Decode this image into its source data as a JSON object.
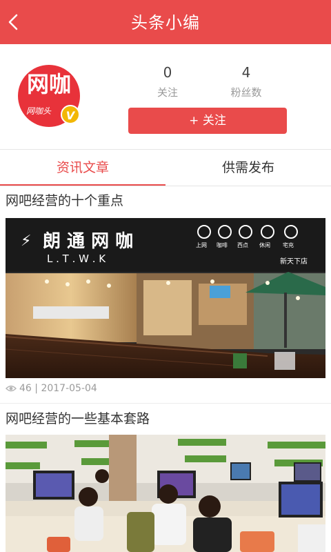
{
  "header": {
    "title": "头条小编",
    "back_icon": "chevron-left-icon"
  },
  "profile": {
    "avatar_text": "网咖",
    "avatar_subtext": "网咖头",
    "verified_badge": "V",
    "following_count": "0",
    "following_label": "关注",
    "fans_count": "4",
    "fans_label": "粉丝数",
    "follow_button": "+ 关注"
  },
  "tabs": [
    {
      "label": "资讯文章",
      "active": true
    },
    {
      "label": "供需发布",
      "active": false
    }
  ],
  "articles": [
    {
      "title": "网吧经营的十个重点",
      "views": "46",
      "date": "2017-05-04",
      "image_sign_text": "朗 通 网 咖",
      "image_sign_latin": "L . T . W . K",
      "image_store_text": "新天下店",
      "image_service_labels": [
        "上网",
        "咖啡",
        "西点",
        "休闲",
        "宅充"
      ]
    },
    {
      "title": "网吧经营的一些基本套路"
    }
  ],
  "colors": {
    "accent": "#e94b4b",
    "text": "#333333",
    "muted": "#9a9a9a"
  }
}
